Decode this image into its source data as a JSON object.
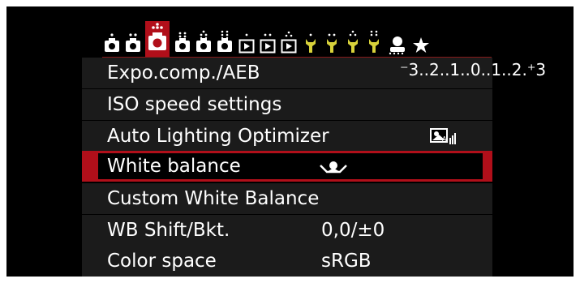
{
  "tabs": [
    {
      "name": "shooting-1",
      "icon": "camera-icon"
    },
    {
      "name": "shooting-2",
      "icon": "camera-icon"
    },
    {
      "name": "shooting-3",
      "icon": "camera-icon",
      "active": true
    },
    {
      "name": "shooting-4",
      "icon": "camera-icon"
    },
    {
      "name": "shooting-5",
      "icon": "camera-icon"
    },
    {
      "name": "shooting-6",
      "icon": "camera-icon"
    },
    {
      "name": "playback-1",
      "icon": "play-icon"
    },
    {
      "name": "playback-2",
      "icon": "play-icon"
    },
    {
      "name": "playback-3",
      "icon": "play-icon"
    },
    {
      "name": "setup-1",
      "icon": "wrench-icon"
    },
    {
      "name": "setup-2",
      "icon": "wrench-icon"
    },
    {
      "name": "setup-3",
      "icon": "wrench-icon"
    },
    {
      "name": "setup-4",
      "icon": "wrench-icon"
    },
    {
      "name": "custom-functions",
      "icon": "custom-functions-icon"
    },
    {
      "name": "my-menu",
      "icon": "star-icon"
    }
  ],
  "menu": {
    "expo": {
      "label": "Expo.comp./AEB",
      "scale": "⁻3..2..1..0..1..2.⁺3"
    },
    "iso": {
      "label": "ISO speed settings"
    },
    "alo": {
      "label": "Auto Lighting Optimizer",
      "value_icon": "auto-lighting-optimizer-icon"
    },
    "wb": {
      "label": "White balance",
      "value_icon": "custom-white-balance-icon",
      "selected": true
    },
    "cwb": {
      "label": "Custom White Balance"
    },
    "wbshift": {
      "label": "WB Shift/Bkt.",
      "value": "0,0/±0"
    },
    "colorspace": {
      "label": "Color space",
      "value": "sRGB"
    }
  },
  "colors": {
    "accent": "#b10f1a",
    "row_bg": "#1b1b1b",
    "screen_bg": "#000000"
  }
}
